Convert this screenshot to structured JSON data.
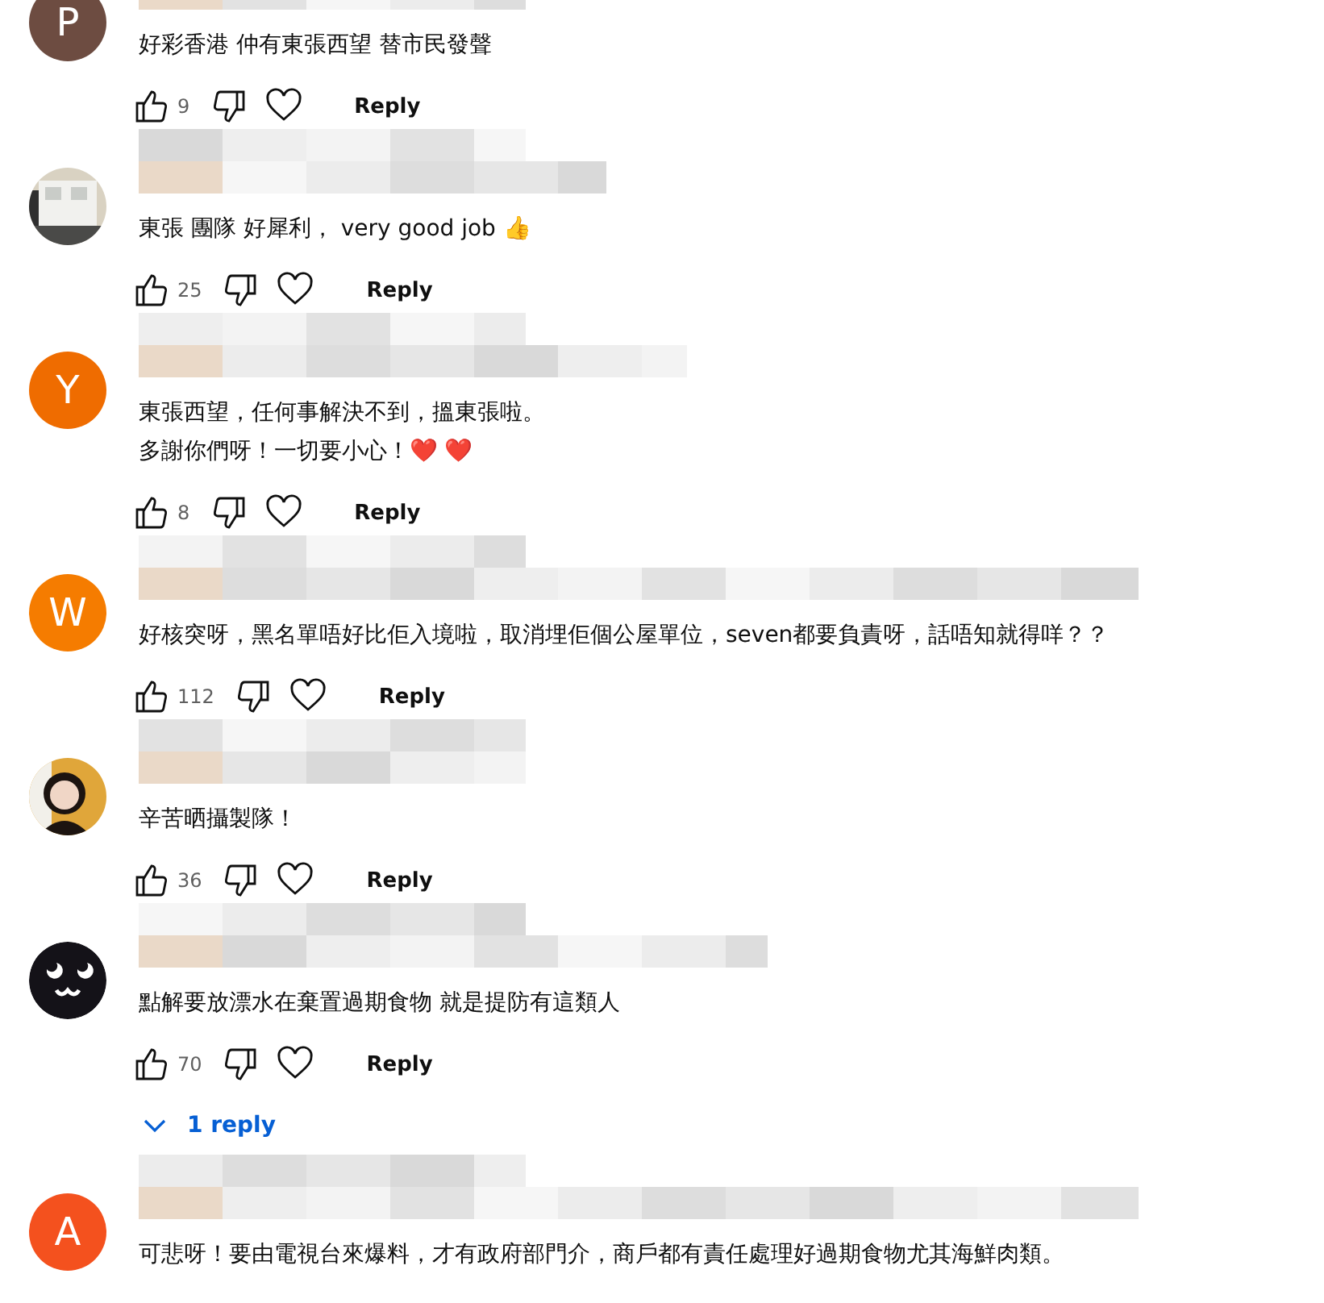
{
  "comments": [
    {
      "avatar": {
        "kind": "letter",
        "letter": "P",
        "color": "#6d4c41"
      },
      "text": "好彩香港 仲有東張西望 替市民發聲",
      "likes": "9",
      "reply": "Reply"
    },
    {
      "text": "東張 團隊 好犀利， very good job 👍",
      "likes": "25",
      "reply": "Reply"
    },
    {
      "avatar": {
        "kind": "letter",
        "letter": "Y",
        "color": "#ef6c00"
      },
      "lines": [
        "東張西望，任何事解決不到，搵東張啦。",
        "多謝你們呀！一切要小心！❤️ ❤️"
      ],
      "likes": "8",
      "reply": "Reply"
    },
    {
      "avatar": {
        "kind": "letter",
        "letter": "W",
        "color": "#f57c00"
      },
      "text": "好核突呀，黑名單唔好比佢入境啦，取消埋佢個公屋單位，seven都要負責呀，話唔知就得咩？？",
      "likes": "112",
      "reply": "Reply"
    },
    {
      "text": "辛苦晒攝製隊！",
      "likes": "36",
      "reply": "Reply"
    },
    {
      "avatar": {
        "kind": "cartoon"
      },
      "text": "點解要放漂水在棄置過期食物 就是提防有這類人",
      "likes": "70",
      "reply": "Reply",
      "replies": "1 reply"
    },
    {
      "avatar": {
        "kind": "letter",
        "letter": "A",
        "color": "#f4511e"
      },
      "text": "可悲呀！要由電視台來爆料，才有政府部門介，商戶都有責任處理好過期食物尤其海鮮肉類。"
    }
  ]
}
